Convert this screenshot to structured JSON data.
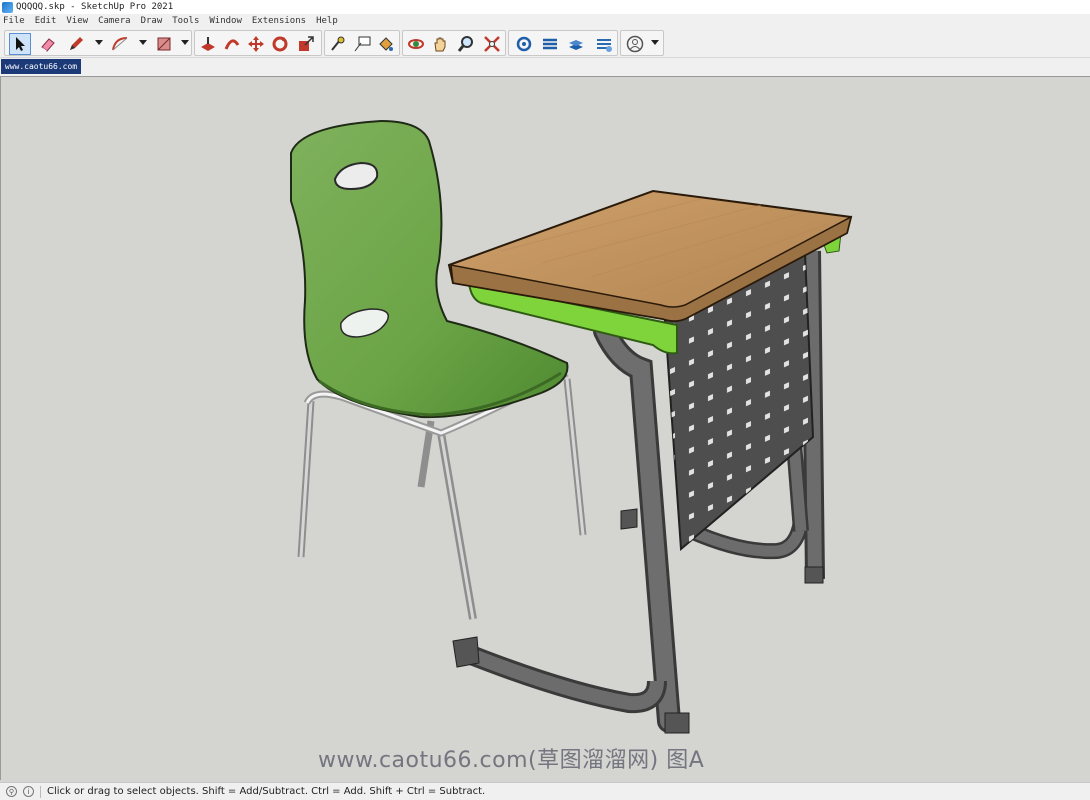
{
  "window": {
    "title": "QQQQQ.skp - SketchUp Pro 2021"
  },
  "menu": [
    "File",
    "Edit",
    "View",
    "Camera",
    "Draw",
    "Tools",
    "Window",
    "Extensions",
    "Help"
  ],
  "scene_tab": {
    "label": "www.caotu66.com"
  },
  "viewport": {
    "background": "#d4d4d0"
  },
  "watermark": {
    "text": "www.caotu66.com(草图溜溜网) 图A"
  },
  "status": {
    "text": "Click or drag to select objects. Shift = Add/Subtract. Ctrl = Add. Shift + Ctrl = Subtract."
  },
  "toolbar_icons": [
    "select-icon",
    "eraser-icon",
    "pencil-icon",
    "arc-icon",
    "rectangle-icon",
    "push-pull-icon",
    "follow-me-icon",
    "move-icon",
    "rotate-icon",
    "scale-icon",
    "tape-measure-icon",
    "text-icon",
    "paint-bucket-icon",
    "orbit-icon",
    "pan-icon",
    "zoom-icon",
    "zoom-extents-icon",
    "3d-warehouse-icon",
    "extension-warehouse-icon",
    "layout-icon",
    "extension-manager-icon",
    "account-icon"
  ]
}
